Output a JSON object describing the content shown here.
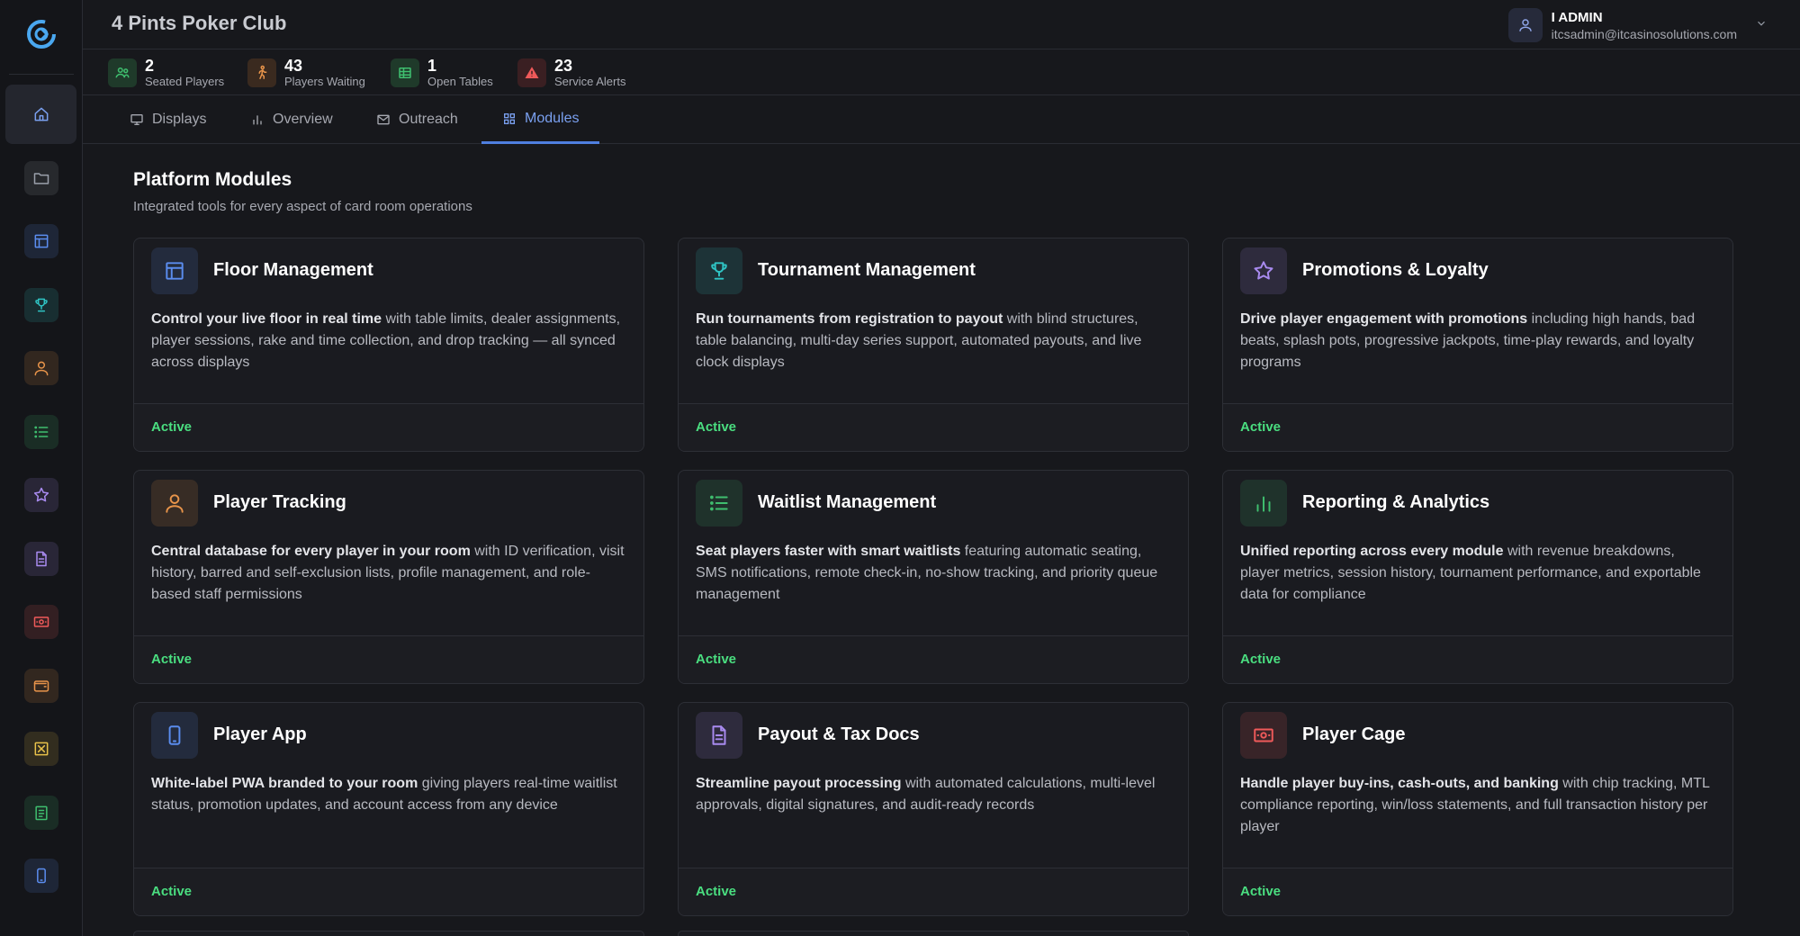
{
  "header": {
    "club_name": "4 Pints Poker Club",
    "user_name": "I ADMIN",
    "user_email": "itcsadmin@itcasinosolutions.com"
  },
  "stats": [
    {
      "value": "2",
      "label": "Seated Players",
      "icon": "users-icon",
      "color": "#3fbf6f"
    },
    {
      "value": "43",
      "label": "Players Waiting",
      "icon": "walking-icon",
      "color": "#e8944a"
    },
    {
      "value": "1",
      "label": "Open Tables",
      "icon": "table-icon",
      "color": "#3fbf6f"
    },
    {
      "value": "23",
      "label": "Service Alerts",
      "icon": "alert-icon",
      "color": "#ef5a5a"
    }
  ],
  "tabs": [
    {
      "label": "Displays",
      "icon": "monitor-icon"
    },
    {
      "label": "Overview",
      "icon": "bar-chart-icon"
    },
    {
      "label": "Outreach",
      "icon": "mail-icon"
    },
    {
      "label": "Modules",
      "icon": "grid-icon",
      "active": true
    }
  ],
  "section": {
    "title": "Platform Modules",
    "subtitle": "Integrated tools for every aspect of card room operations"
  },
  "modules": [
    {
      "title": "Floor Management",
      "bold": "Control your live floor in real time",
      "rest": " with table limits, dealer assignments, player sessions, rake and time collection, and drop tracking — all synced across displays",
      "status": "Active",
      "icon": "layout-icon",
      "color": "#5b8def"
    },
    {
      "title": "Tournament Management",
      "bold": "Run tournaments from registration to payout",
      "rest": " with blind structures, table balancing, multi-day series support, automated payouts, and live clock displays",
      "status": "Active",
      "icon": "trophy-icon",
      "color": "#2fc4c4"
    },
    {
      "title": "Promotions & Loyalty",
      "bold": "Drive player engagement with promotions",
      "rest": " including high hands, bad beats, splash pots, progressive jackpots, time-play rewards, and loyalty programs",
      "status": "Active",
      "icon": "star-icon",
      "color": "#a98bf0"
    },
    {
      "title": "Player Tracking",
      "bold": "Central database for every player in your room",
      "rest": " with ID verification, visit history, barred and self-exclusion lists, profile management, and role-based staff permissions",
      "status": "Active",
      "icon": "user-icon",
      "color": "#e8944a"
    },
    {
      "title": "Waitlist Management",
      "bold": "Seat players faster with smart waitlists",
      "rest": " featuring automatic seating, SMS notifications, remote check-in, no-show tracking, and priority queue management",
      "status": "Active",
      "icon": "list-icon",
      "color": "#3fbf6f"
    },
    {
      "title": "Reporting & Analytics",
      "bold": "Unified reporting across every module",
      "rest": " with revenue breakdowns, player metrics, session history, tournament performance, and exportable data for compliance",
      "status": "Active",
      "icon": "analytics-icon",
      "color": "#3fbf6f"
    },
    {
      "title": "Player App",
      "bold": "White-label PWA branded to your room",
      "rest": " giving players real-time waitlist status, promotion updates, and account access from any device",
      "status": "Active",
      "icon": "phone-icon",
      "color": "#5b8def"
    },
    {
      "title": "Payout & Tax Docs",
      "bold": "Streamline payout processing",
      "rest": " with automated calculations, multi-level approvals, digital signatures, and audit-ready records",
      "status": "Active",
      "icon": "document-icon",
      "color": "#a98bf0"
    },
    {
      "title": "Player Cage",
      "bold": "Handle player buy-ins, cash-outs, and banking",
      "rest": " with chip tracking, MTL compliance reporting, win/loss statements, and full transaction history per player",
      "status": "Active",
      "icon": "cash-icon",
      "color": "#ef5a5a"
    }
  ],
  "sidebar": [
    {
      "name": "home",
      "color": "#7aa0f0",
      "active": true
    },
    {
      "name": "folder",
      "color": "#9aa0ab"
    },
    {
      "name": "layout",
      "color": "#5b8def"
    },
    {
      "name": "trophy",
      "color": "#2fc4c4"
    },
    {
      "name": "user",
      "color": "#e8944a"
    },
    {
      "name": "list",
      "color": "#3fbf6f"
    },
    {
      "name": "star",
      "color": "#a98bf0"
    },
    {
      "name": "document",
      "color": "#a98bf0"
    },
    {
      "name": "cash",
      "color": "#ef5a5a"
    },
    {
      "name": "wallet",
      "color": "#e8944a"
    },
    {
      "name": "receipt",
      "color": "#e8c14a"
    },
    {
      "name": "clipboard",
      "color": "#3fbf6f"
    },
    {
      "name": "phone",
      "color": "#5b8def"
    }
  ]
}
